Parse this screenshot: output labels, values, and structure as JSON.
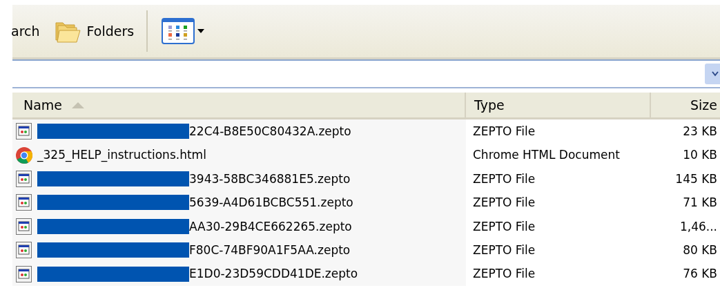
{
  "toolbar": {
    "buttons": [
      {
        "label": "arch",
        "kind": "text"
      },
      {
        "label": "Folders",
        "kind": "folders"
      },
      {
        "kind": "views"
      }
    ]
  },
  "columns": [
    {
      "label": "Name",
      "sorted": true
    },
    {
      "label": "Type",
      "sorted": false
    },
    {
      "label": "Size",
      "sorted": false
    }
  ],
  "rows": [
    {
      "kind": "zepto",
      "redacted": true,
      "name": "22C4-B8E50C80432A.zepto",
      "type": "ZEPTO File",
      "size": "23 KB"
    },
    {
      "kind": "html",
      "redacted": false,
      "name": "_325_HELP_instructions.html",
      "type": "Chrome HTML Document",
      "size": "10 KB"
    },
    {
      "kind": "zepto",
      "redacted": true,
      "name": "3943-58BC346881E5.zepto",
      "type": "ZEPTO File",
      "size": "145 KB"
    },
    {
      "kind": "zepto",
      "redacted": true,
      "name": "5639-A4D61BCBC551.zepto",
      "type": "ZEPTO File",
      "size": "71 KB"
    },
    {
      "kind": "zepto",
      "redacted": true,
      "name": "AA30-29B4CE662265.zepto",
      "type": "ZEPTO File",
      "size": "1,46..."
    },
    {
      "kind": "zepto",
      "redacted": true,
      "name": "F80C-74BF90A1F5AA.zepto",
      "type": "ZEPTO File",
      "size": "80 KB"
    },
    {
      "kind": "zepto",
      "redacted": true,
      "name": "E1D0-23D59CDD41DE.zepto",
      "type": "ZEPTO File",
      "size": "76 KB"
    }
  ]
}
